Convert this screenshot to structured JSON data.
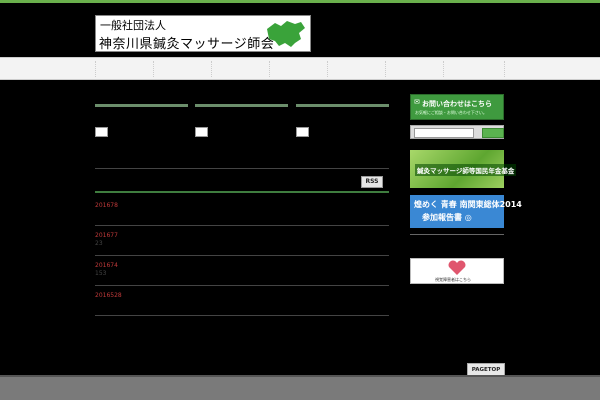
{
  "header": {
    "logo_line1": "一般社団法人",
    "logo_line2": "神奈川県鍼灸マッサージ師会"
  },
  "nav": {
    "items": [
      "",
      "",
      "",
      "",
      "",
      "",
      ""
    ]
  },
  "main": {
    "rss_label": "RSS",
    "posts": [
      {
        "date": "201678",
        "sub": ""
      },
      {
        "date": "201677",
        "sub": "23"
      },
      {
        "date": "201674",
        "sub": "153"
      },
      {
        "date": "2016528",
        "sub": ""
      }
    ]
  },
  "sidebar": {
    "contact_title": "お問い合わせはこちら",
    "contact_sub": "お気軽にご相談・お問い合わせ下さい。",
    "banner_green": "鍼灸マッサージ師等国民年金基金",
    "banner_blue_line1": "煌めく 青春 南関東総体2014",
    "banner_blue_line2": "参加報告書 ◎",
    "banner_heart": "視覚障害者はこちら"
  },
  "pagetop_label": "PAGETOP",
  "colors": {
    "accent": "#6ab04c",
    "post_date": "#c03a3a",
    "banner_blue": "#3a88d4"
  }
}
